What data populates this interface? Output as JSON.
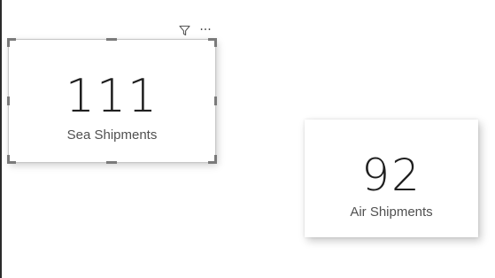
{
  "report": {
    "cards": [
      {
        "value": "111",
        "label": "Sea Shipments"
      },
      {
        "value": "92",
        "label": "Air Shipments"
      }
    ],
    "visual_header": {
      "filter_icon": "filter-icon",
      "more_options_glyph": "···"
    }
  },
  "colors": {
    "value_text": "#1f1f1f",
    "label_text": "#505050",
    "selection_handle": "#7a7a7a"
  }
}
